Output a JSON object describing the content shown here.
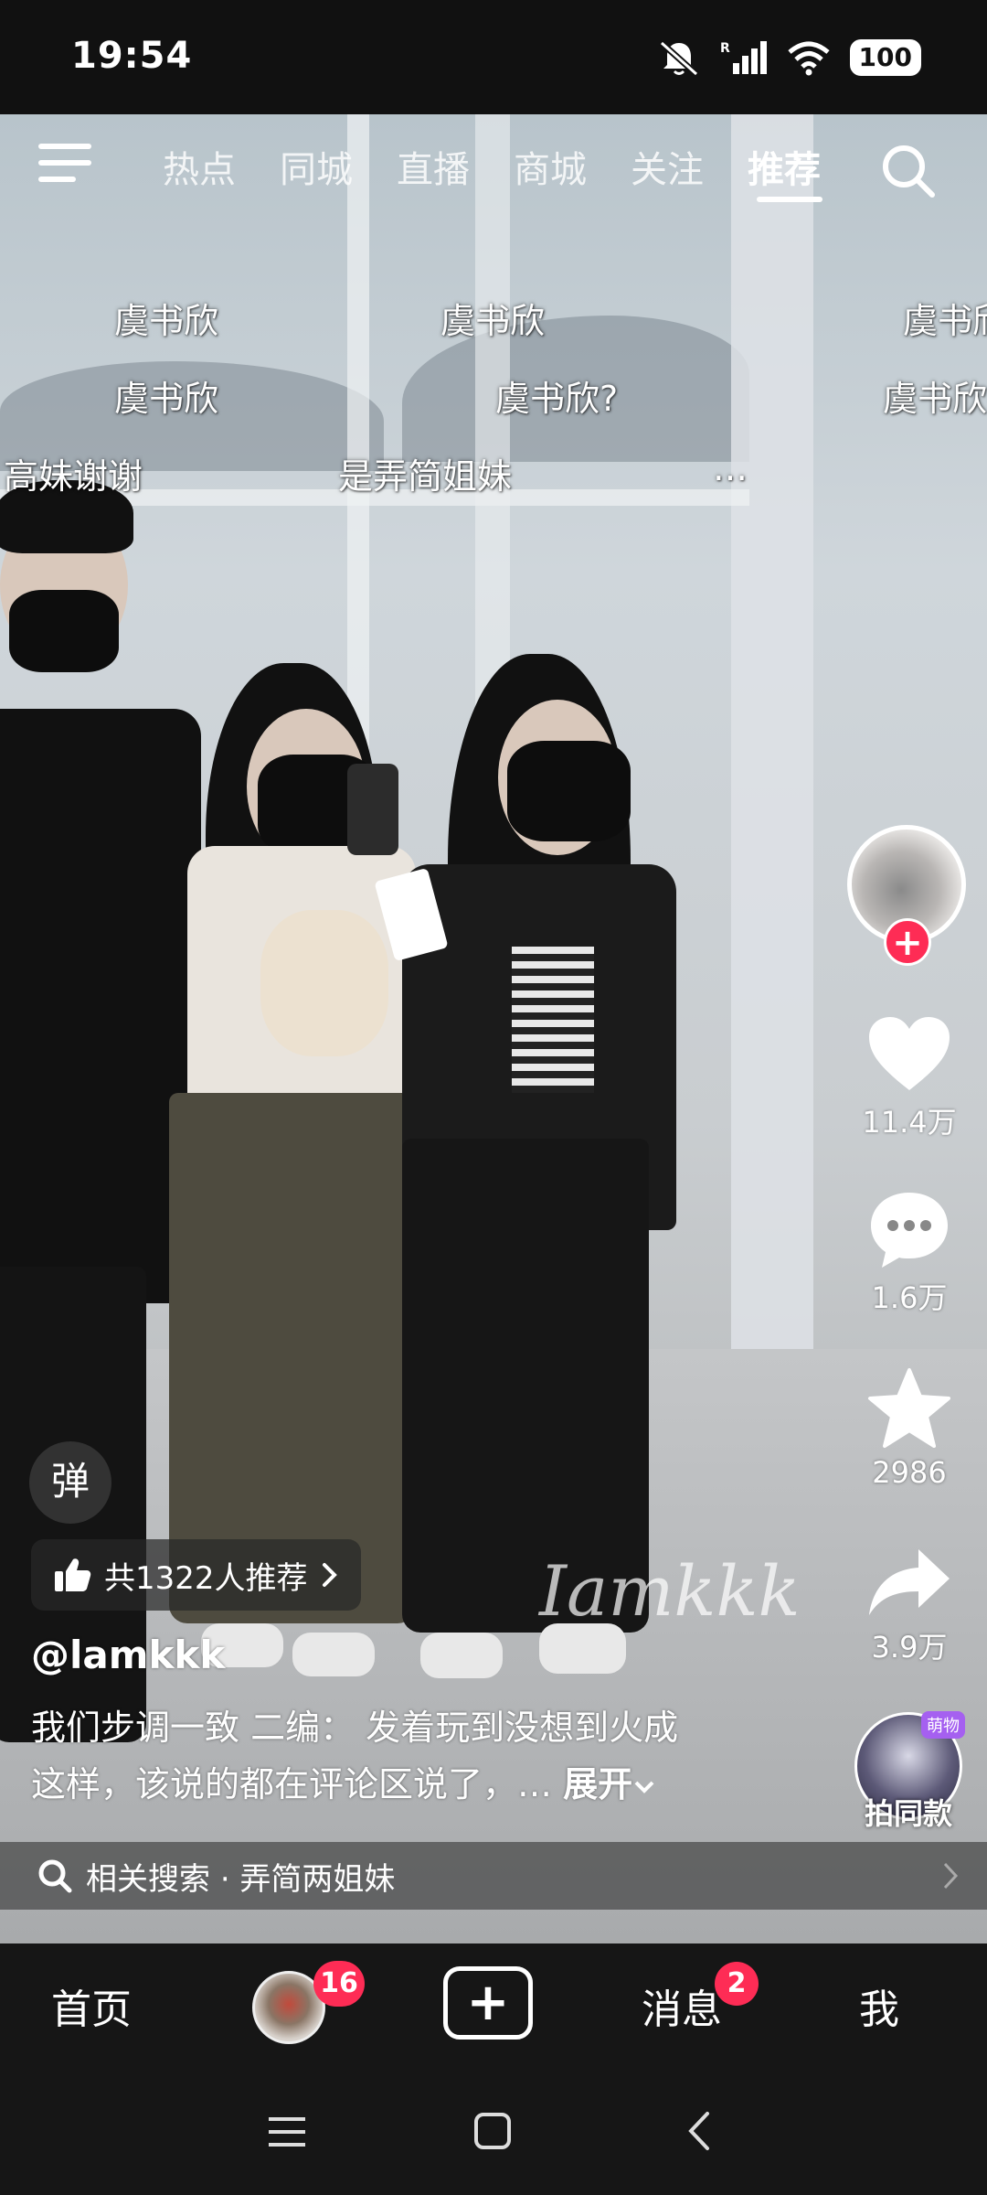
{
  "status_bar": {
    "time": "19:54",
    "battery": "100",
    "signal_label": "R",
    "icons": [
      "mute-icon",
      "signal-icon",
      "wifi-icon",
      "battery-icon"
    ]
  },
  "top_nav": {
    "tabs": [
      "热点",
      "同城",
      "直播",
      "商城",
      "关注",
      "推荐"
    ],
    "active_tab": "推荐",
    "icons": [
      "menu-icon",
      "search-icon"
    ]
  },
  "danmaku": [
    "虞书欣",
    "虞书欣",
    "虞书欣",
    "虞书欣",
    "虞书欣?",
    "虞书欣",
    "高妹谢谢",
    "是弄简姐妹",
    "…"
  ],
  "video": {
    "watermark": "Iamkkk"
  },
  "right_rail": {
    "likes": "11.4万",
    "comments": "1.6万",
    "favorites": "2986",
    "shares": "3.9万",
    "same_style_label": "拍同款",
    "same_style_tag": "萌物"
  },
  "danmu_button": "弹",
  "recommend_pill": "共1322人推荐",
  "author": "@lamkkk",
  "caption": {
    "line1": "我们步调一致 二编： 发着玩到没想到火成",
    "line2": "这样，该说的都在评论区说了，…",
    "expand": "展开"
  },
  "related_search": {
    "prefix": "相关搜索",
    "dot": "·",
    "query": "弄简两姐妹"
  },
  "bottom_nav": {
    "home": "首页",
    "friends_badge": "16",
    "messages": "消息",
    "messages_badge": "2",
    "me": "我"
  },
  "colors": {
    "accent": "#fe2c55",
    "nav_bg": "#161616"
  }
}
